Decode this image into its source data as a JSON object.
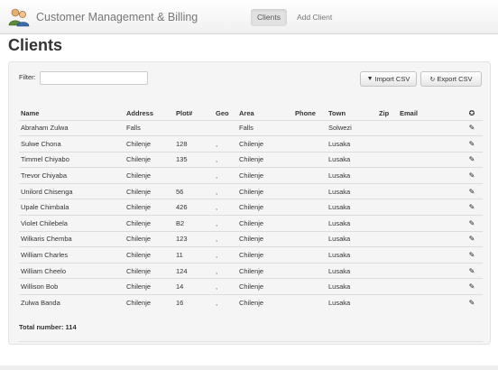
{
  "app": {
    "title": "Customer Management & Billing",
    "logo_icon": "users-icon",
    "nav": [
      {
        "label": "Clients",
        "active": true
      },
      {
        "label": "Add Client",
        "active": false
      }
    ]
  },
  "page": {
    "title": "Clients"
  },
  "filter": {
    "label": "Filter:",
    "value": "",
    "placeholder": ""
  },
  "buttons": {
    "import": {
      "label": "Import CSV",
      "icon": "filter-icon"
    },
    "export": {
      "label": "Export CSV",
      "icon": "refresh-icon"
    }
  },
  "table": {
    "columns": [
      "Name",
      "Address",
      "Plot#",
      "Geo",
      "Area",
      "Phone",
      "Town",
      "Zip",
      "Email"
    ],
    "settings_icon": "gear-icon",
    "row_icon": "pencil-icon",
    "rows": [
      [
        "Abraham Zulwa",
        "Falls",
        "",
        "",
        "Falls",
        "",
        "Solwezi",
        "",
        ""
      ],
      [
        "Sulwe Chona",
        "Chilenje",
        "128",
        ",",
        "Chilenje",
        "",
        "Lusaka",
        "",
        ""
      ],
      [
        "Timmel Chiyabo",
        "Chilenje",
        "135",
        ",",
        "Chilenje",
        "",
        "Lusaka",
        "",
        ""
      ],
      [
        "Trevor Chiyaba",
        "Chilenje",
        "",
        ",",
        "Chilenje",
        "",
        "Lusaka",
        "",
        ""
      ],
      [
        "Unilord Chisenga",
        "Chilenje",
        "56",
        ",",
        "Chilenje",
        "",
        "Lusaka",
        "",
        ""
      ],
      [
        "Upale Chimbala",
        "Chilenje",
        "426",
        ",",
        "Chilenje",
        "",
        "Lusaka",
        "",
        ""
      ],
      [
        "Violet Chilebela",
        "Chilenje",
        "B2",
        ",",
        "Chilenje",
        "",
        "Lusaka",
        "",
        ""
      ],
      [
        "Wilkaris Chemba",
        "Chilenje",
        "123",
        ",",
        "Chilenje",
        "",
        "Lusaka",
        "",
        ""
      ],
      [
        "William Charles",
        "Chilenje",
        "11",
        ",",
        "Chilenje",
        "",
        "Lusaka",
        "",
        ""
      ],
      [
        "William Cheelo",
        "Chilenje",
        "124",
        ",",
        "Chilenje",
        "",
        "Lusaka",
        "",
        ""
      ],
      [
        "Willison Bob",
        "Chilenje",
        "14",
        ",",
        "Chilenje",
        "",
        "Lusaka",
        "",
        ""
      ],
      [
        "Zulwa Banda",
        "Chilenje",
        "16",
        ",",
        "Chilenje",
        "",
        "Lusaka",
        "",
        ""
      ]
    ]
  },
  "summary": {
    "total_text": "Total number: 114"
  },
  "colors": {
    "navbar_bg": "#f2f2f2",
    "well_bg": "#f5f5f5",
    "text": "#333333",
    "nav_text": "#777777"
  }
}
